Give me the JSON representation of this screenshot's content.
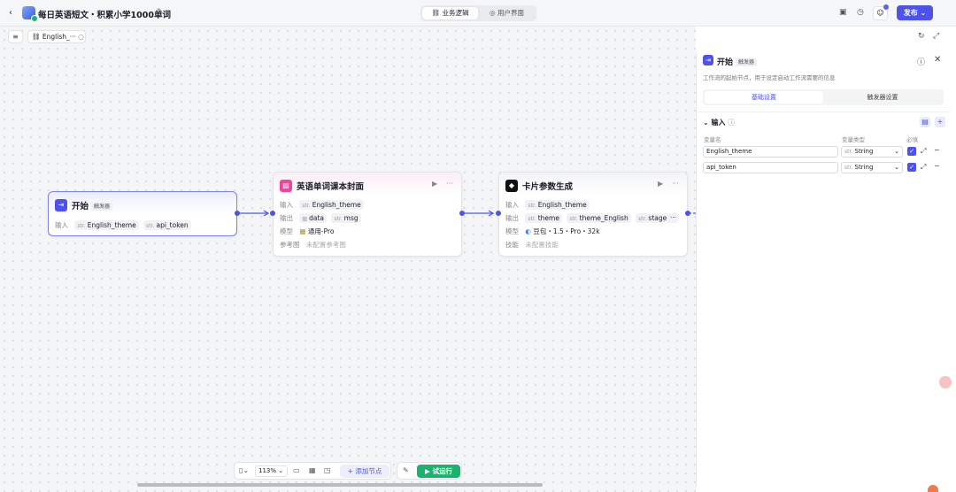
{
  "topbar": {
    "title": "每日英语短文・积累小学1000单词",
    "tabs": [
      {
        "label": "业务逻辑",
        "active": true
      },
      {
        "label": "用户界面",
        "active": false
      }
    ],
    "publish_label": "发布"
  },
  "canvas": {
    "workflow_chip": "English_···"
  },
  "nodes": {
    "start": {
      "title": "开始",
      "badge": "触发器",
      "input_label": "输入",
      "inputs": [
        {
          "type": "str.",
          "name": "English_theme"
        },
        {
          "type": "str.",
          "name": "api_token"
        }
      ]
    },
    "cover": {
      "title": "英语单词课本封面",
      "input_label": "输入",
      "inputs": [
        {
          "type": "str.",
          "name": "English_theme"
        }
      ],
      "output_label": "输出",
      "outputs": [
        {
          "type": "img",
          "name": "data"
        },
        {
          "type": "str.",
          "name": "msg"
        }
      ],
      "model_label": "模型",
      "model_value": "通用-Pro",
      "ref_label": "参考图",
      "ref_value": "未配置参考图"
    },
    "card": {
      "title": "卡片参数生成",
      "input_label": "输入",
      "inputs": [
        {
          "type": "str.",
          "name": "English_theme"
        }
      ],
      "output_label": "输出",
      "outputs": [
        {
          "type": "str.",
          "name": "theme"
        },
        {
          "type": "str.",
          "name": "theme_English"
        },
        {
          "type": "str.",
          "name": "stage"
        }
      ],
      "model_label": "模型",
      "model_value": "豆包・1.5・Pro・32k",
      "skill_label": "技能",
      "skill_value": "未配置技能"
    }
  },
  "bottom": {
    "zoom": "113%",
    "add_node": "添加节点",
    "run": "试运行"
  },
  "panel": {
    "title": "开始",
    "badge": "触发器",
    "description": "工作流的起始节点，用于设定启动工作流需要的信息",
    "tabs": [
      {
        "label": "基础设置",
        "active": true
      },
      {
        "label": "触发器设置",
        "active": false
      }
    ],
    "section": "输入",
    "col_name": "变量名",
    "col_type": "变量类型",
    "col_required": "必填",
    "vars": [
      {
        "name": "English_theme",
        "type": "String",
        "required": true
      },
      {
        "name": "api_token",
        "type": "String",
        "required": true
      }
    ]
  }
}
